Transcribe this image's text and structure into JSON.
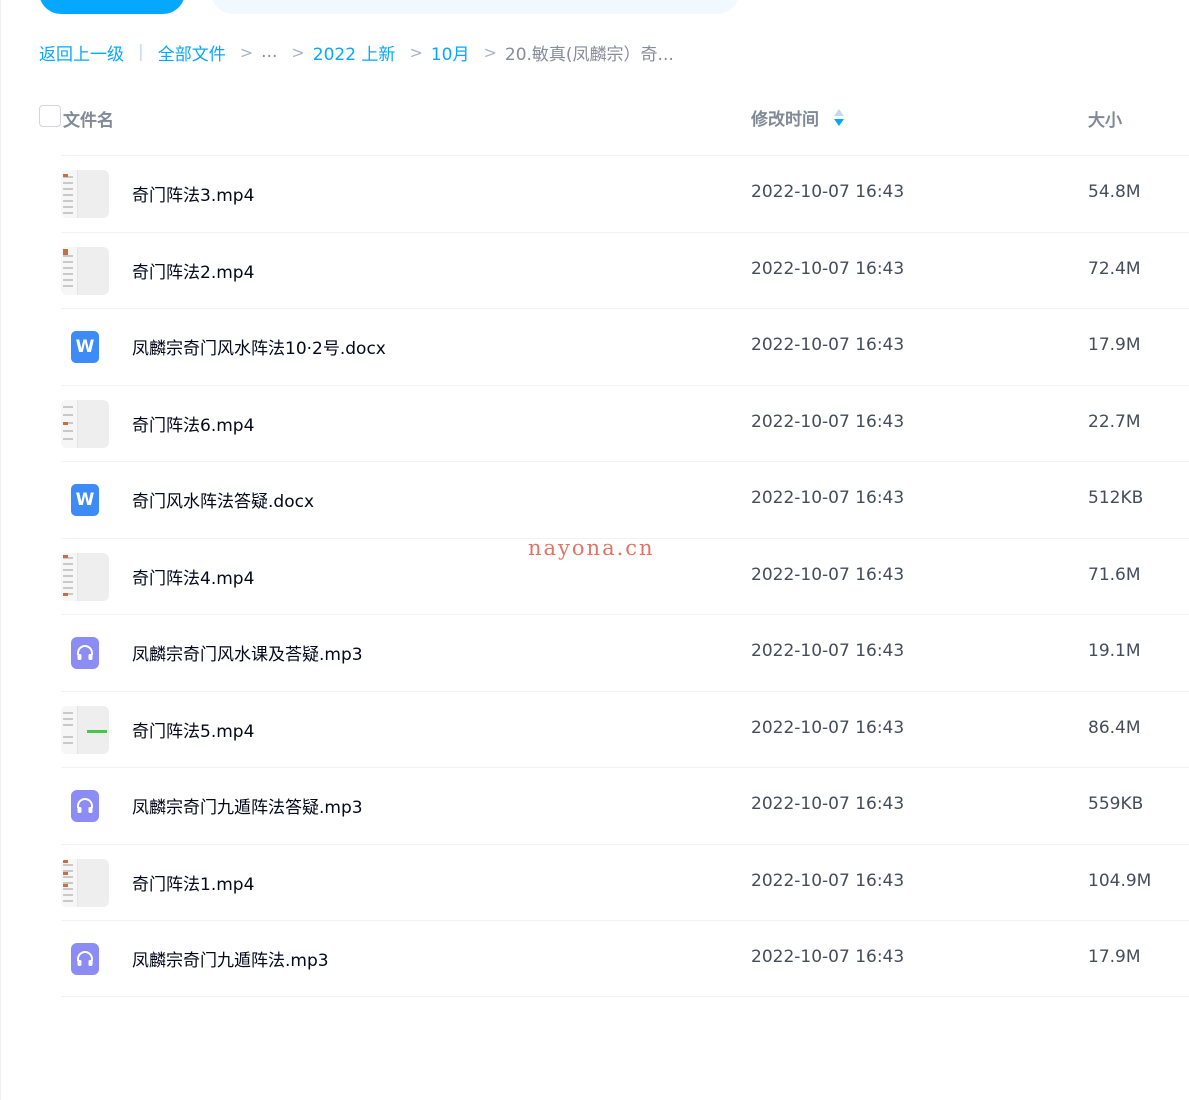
{
  "breadcrumb": {
    "back": "返回上一级",
    "bar": "|",
    "sep": ">",
    "items": [
      "全部文件",
      "...",
      "2022 上新",
      "10月"
    ],
    "current": "20.敏真(凤麟宗）奇..."
  },
  "header": {
    "name": "文件名",
    "time": "修改时间",
    "size": "大小"
  },
  "files": [
    {
      "name": "奇门阵法3.mp4",
      "time": "2022-10-07 16:43",
      "size": "54.8M",
      "icon": "video-thumbnail"
    },
    {
      "name": "奇门阵法2.mp4",
      "time": "2022-10-07 16:43",
      "size": "72.4M",
      "icon": "video-thumbnail"
    },
    {
      "name": "凤麟宗奇门风水阵法10·2号.docx",
      "time": "2022-10-07 16:43",
      "size": "17.9M",
      "icon": "word-doc-icon",
      "icon_letter": "W"
    },
    {
      "name": "奇门阵法6.mp4",
      "time": "2022-10-07 16:43",
      "size": "22.7M",
      "icon": "video-thumbnail"
    },
    {
      "name": "奇门风水阵法答疑.docx",
      "time": "2022-10-07 16:43",
      "size": "512KB",
      "icon": "word-doc-icon",
      "icon_letter": "W"
    },
    {
      "name": "奇门阵法4.mp4",
      "time": "2022-10-07 16:43",
      "size": "71.6M",
      "icon": "video-thumbnail"
    },
    {
      "name": "凤麟宗奇门风水课及荅疑.mp3",
      "time": "2022-10-07 16:43",
      "size": "19.1M",
      "icon": "audio-headphones-icon"
    },
    {
      "name": "奇门阵法5.mp4",
      "time": "2022-10-07 16:43",
      "size": "86.4M",
      "icon": "video-thumbnail"
    },
    {
      "name": "凤麟宗奇门九遁阵法答疑.mp3",
      "time": "2022-10-07 16:43",
      "size": "559KB",
      "icon": "audio-headphones-icon"
    },
    {
      "name": "奇门阵法1.mp4",
      "time": "2022-10-07 16:43",
      "size": "104.9M",
      "icon": "video-thumbnail"
    },
    {
      "name": "凤麟宗奇门九遁阵法.mp3",
      "time": "2022-10-07 16:43",
      "size": "17.9M",
      "icon": "audio-headphones-icon"
    }
  ],
  "watermark": "nayona.cn",
  "colors": {
    "accent": "#06a7ff",
    "word_icon": "#3d8bf7",
    "audio_icon": "#8c8cf5",
    "watermark": "#e05a4a"
  }
}
